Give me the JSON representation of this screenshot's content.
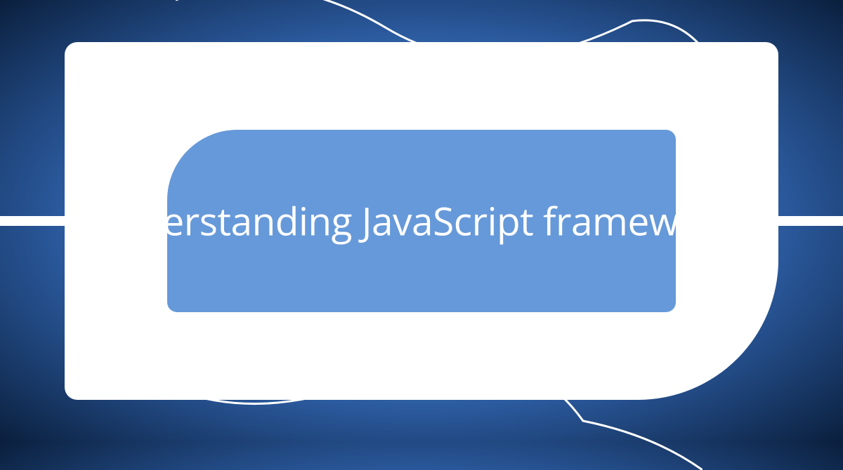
{
  "card": {
    "title": "Understanding JavaScript frameworks"
  },
  "colors": {
    "background_gradient_center": "#6aa8e8",
    "background_gradient_edge": "#0a1f3d",
    "shape_white": "#ffffff",
    "inner_blue": "#6699d9"
  }
}
